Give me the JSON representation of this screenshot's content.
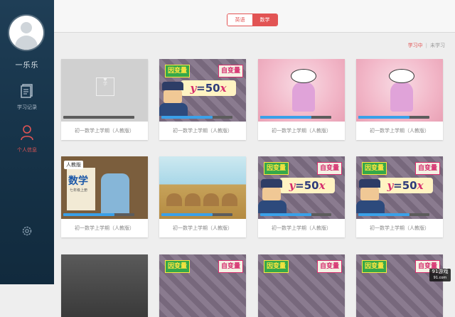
{
  "user": {
    "name": "一乐乐"
  },
  "nav": [
    {
      "label": "学习记录",
      "icon": "records-icon"
    },
    {
      "label": "个人信息",
      "icon": "user-icon"
    }
  ],
  "settings_icon": "gear-icon",
  "subjects": {
    "english": "英语",
    "math": "数学",
    "selected": "数学"
  },
  "subtabs": {
    "learning": "学习中",
    "finished": "未学习",
    "active": "学习中"
  },
  "colors": {
    "accent": "#e25454",
    "sidebar": "#17344a",
    "progress": "#3aa0e8"
  },
  "courses": [
    {
      "title": "初一数学上学期（人教版）",
      "progress": 0.0
    },
    {
      "title": "初一数学上学期（人教版）",
      "progress": 0.72,
      "thumb_text": {
        "left": "因变量",
        "right": "自变量",
        "eq_y": "y",
        "eq_mid": "=50",
        "eq_x": "x"
      }
    },
    {
      "title": "初一数学上学期（人教版）",
      "progress": 0.72
    },
    {
      "title": "初一数学上学期（人教版）",
      "progress": 0.72
    },
    {
      "title": "初一数学上学期（人教版）",
      "progress": 0.72,
      "thumb_text": {
        "tag": "人教版",
        "title": "数学",
        "sub": "七年级上册"
      }
    },
    {
      "title": "初一数学上学期（人教版）",
      "progress": 0.72
    },
    {
      "title": "初一数学上学期（人教版）",
      "progress": 0.72,
      "thumb_text": {
        "left": "因变量",
        "right": "自变量",
        "eq_y": "y",
        "eq_mid": "=50",
        "eq_x": "x"
      }
    },
    {
      "title": "初一数学上学期（人教版）",
      "progress": 0.72,
      "thumb_text": {
        "left": "因变量",
        "right": "自变量",
        "eq_y": "y",
        "eq_mid": "=50",
        "eq_x": "x"
      }
    },
    {
      "title": "",
      "progress": null
    },
    {
      "title": "",
      "progress": null,
      "thumb_text": {
        "left": "因变量",
        "right": "自变量"
      }
    },
    {
      "title": "",
      "progress": null,
      "thumb_text": {
        "left": "因变量",
        "right": "自变量"
      }
    },
    {
      "title": "",
      "progress": null,
      "thumb_text": {
        "left": "因变量",
        "right": "自变量"
      }
    }
  ],
  "watermark": {
    "line1": "91游戏",
    "line2": "91.com"
  }
}
